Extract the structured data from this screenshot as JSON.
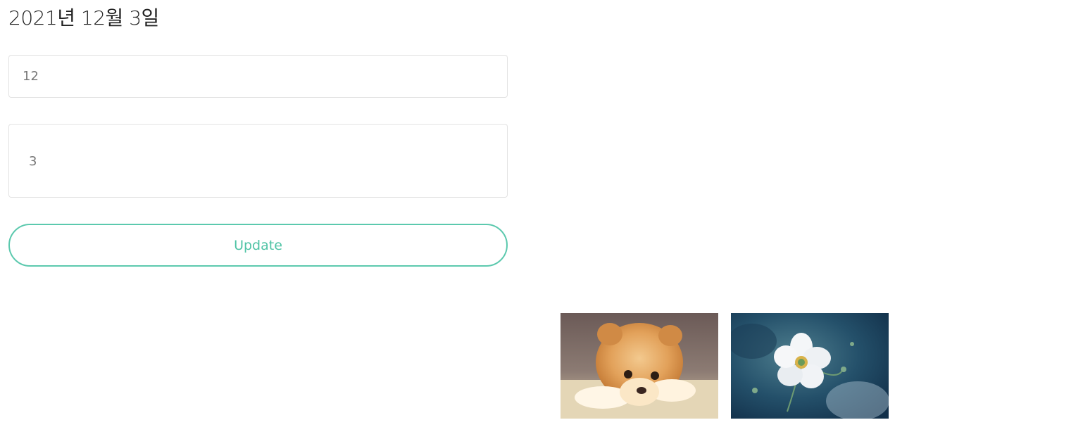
{
  "header": {
    "date_title": "2021년 12월 3일"
  },
  "form": {
    "month_value": "12",
    "day_value": "3",
    "update_label": "Update"
  },
  "gallery": {
    "images": [
      {
        "subject": "puppy-photo"
      },
      {
        "subject": "white-flower-photo"
      }
    ]
  },
  "colors": {
    "accent": "#5cc9ae",
    "border": "#e2e2e2"
  }
}
